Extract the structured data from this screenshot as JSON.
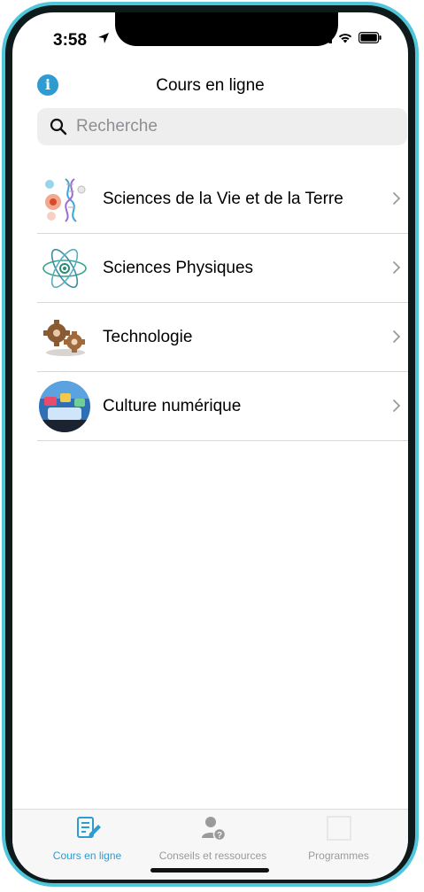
{
  "status": {
    "time": "3:58"
  },
  "header": {
    "title": "Cours en ligne"
  },
  "search": {
    "placeholder": "Recherche",
    "value": ""
  },
  "courses": [
    {
      "label": "Sciences de la Vie et de la Terre",
      "icon": "biology-dna-icon"
    },
    {
      "label": "Sciences Physiques",
      "icon": "atom-icon"
    },
    {
      "label": "Technologie",
      "icon": "gears-icon"
    },
    {
      "label": "Culture numérique",
      "icon": "digital-culture-icon"
    }
  ],
  "tabs": [
    {
      "label": "Cours en ligne",
      "icon": "edit-document-icon",
      "active": true
    },
    {
      "label": "Conseils et ressources",
      "icon": "user-help-icon",
      "active": false
    },
    {
      "label": "Programmes",
      "icon": "programs-icon",
      "active": false
    }
  ],
  "colors": {
    "accent": "#2e9bd1",
    "frame": "#4fc6d9",
    "tab_inactive": "#9a9a9a"
  }
}
